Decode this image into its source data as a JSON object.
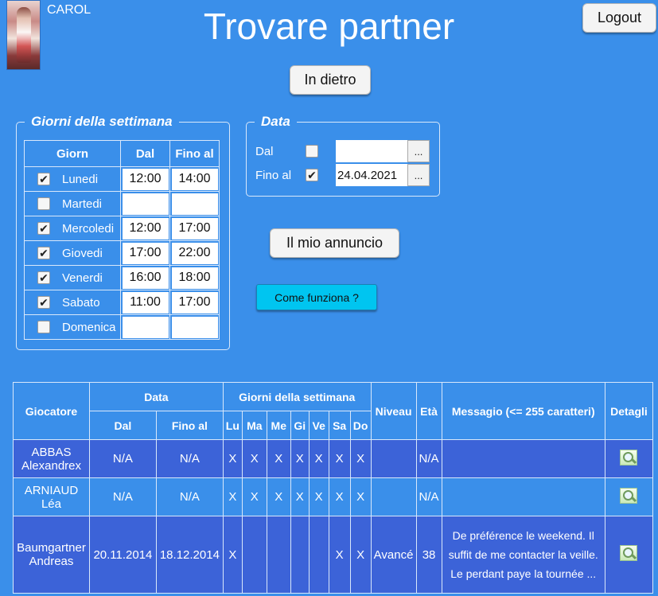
{
  "header": {
    "username": "CAROL",
    "title": "Trovare partner",
    "logout_label": "Logout"
  },
  "nav": {
    "back_label": "In dietro",
    "my_ad_label": "Il mio annuncio",
    "how_label": "Come funziona ?"
  },
  "days_box": {
    "legend": "Giorni della settimana",
    "col_day": "Giorn",
    "col_from": "Dal",
    "col_to": "Fino al",
    "rows": [
      {
        "name": "Lunedi",
        "checked": true,
        "from": "12:00",
        "to": "14:00"
      },
      {
        "name": "Martedi",
        "checked": false,
        "from": "",
        "to": ""
      },
      {
        "name": "Mercoledi",
        "checked": true,
        "from": "12:00",
        "to": "17:00"
      },
      {
        "name": "Giovedi",
        "checked": true,
        "from": "17:00",
        "to": "22:00"
      },
      {
        "name": "Venerdi",
        "checked": true,
        "from": "16:00",
        "to": "18:00"
      },
      {
        "name": "Sabato",
        "checked": true,
        "from": "11:00",
        "to": "17:00"
      },
      {
        "name": "Domenica",
        "checked": false,
        "from": "",
        "to": ""
      }
    ]
  },
  "date_box": {
    "legend": "Data",
    "from_label": "Dal",
    "from_checked": false,
    "from_value": "",
    "to_label": "Fino al",
    "to_checked": true,
    "to_value": "24.04.2021",
    "picker_label": "..."
  },
  "results": {
    "headers": {
      "player": "Giocatore",
      "data": "Data",
      "data_from": "Dal",
      "data_to": "Fino al",
      "week": "Giorni della settimana",
      "days": [
        "Lu",
        "Ma",
        "Me",
        "Gi",
        "Ve",
        "Sa",
        "Do"
      ],
      "level": "Niveau",
      "age": "Età",
      "message": "Messagio (<= 255 caratteri)",
      "details": "Detagli"
    },
    "rows": [
      {
        "player": "ABBAS Alexandrex",
        "from": "N/A",
        "to": "N/A",
        "days": [
          "X",
          "X",
          "X",
          "X",
          "X",
          "X",
          "X"
        ],
        "level": "",
        "age": "N/A",
        "message": ""
      },
      {
        "player": "ARNIAUD Léa",
        "from": "N/A",
        "to": "N/A",
        "days": [
          "X",
          "X",
          "X",
          "X",
          "X",
          "X",
          "X"
        ],
        "level": "",
        "age": "N/A",
        "message": ""
      },
      {
        "player": "Baumgartner Andreas",
        "from": "20.11.2014",
        "to": "18.12.2014",
        "days": [
          "X",
          "",
          "",
          "",
          "",
          "X",
          "X"
        ],
        "level": "Avancé",
        "age": "38",
        "message": "De préférence le weekend. Il suffit de me contacter la veille. Le perdant paye la tournée ..."
      }
    ]
  },
  "icons": {
    "details": "magnifier-icon",
    "checkbox": "checkmark-icon"
  }
}
